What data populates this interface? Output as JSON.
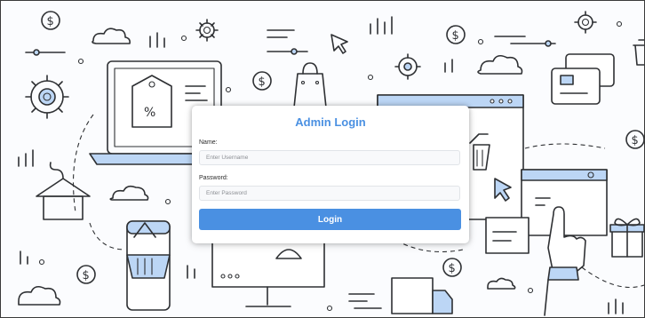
{
  "login": {
    "title": "Admin Login",
    "name_label": "Name:",
    "username_placeholder": "Enter Username",
    "password_label": "Password:",
    "password_placeholder": "Enter Password",
    "button_label": "Login"
  },
  "icons": [
    "dollar-icon",
    "cloud-icon",
    "gear-icon",
    "cursor-arrow-icon",
    "laptop-icon",
    "price-tag-icon",
    "shopping-bag-icon",
    "browser-window-icon",
    "shopping-cart-icon",
    "credit-card-icon",
    "clothes-hanger-icon",
    "smartphone-icon",
    "shopping-basket-icon",
    "monitor-icon",
    "pointing-hand-icon",
    "gift-icon",
    "delivery-box-icon",
    "trash-icon"
  ],
  "colors": {
    "accent": "#4a90e2",
    "illustration_fill": "#bcd6f5",
    "ink": "#2e3033"
  }
}
